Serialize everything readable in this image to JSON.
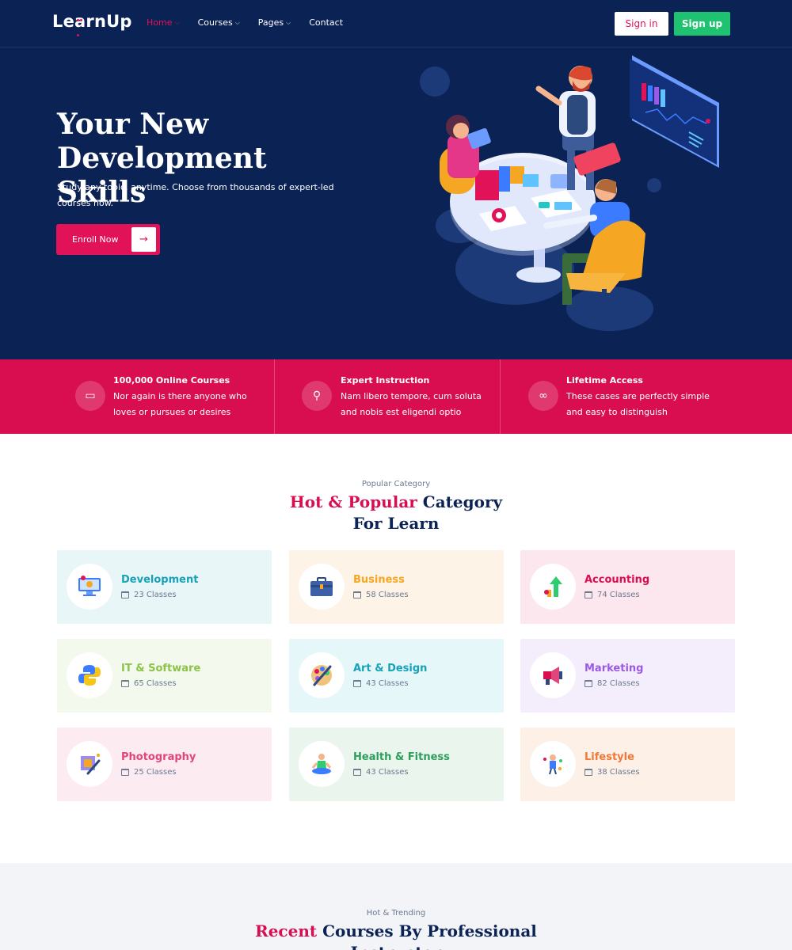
{
  "header": {
    "logo": "LearnUp",
    "nav": [
      {
        "label": "Home",
        "active": true,
        "dropdown": true
      },
      {
        "label": "Courses",
        "active": false,
        "dropdown": true
      },
      {
        "label": "Pages",
        "active": false,
        "dropdown": true
      },
      {
        "label": "Contact",
        "active": false,
        "dropdown": false
      }
    ],
    "signin_label": "Sign in",
    "signup_label": "Sign up"
  },
  "hero": {
    "title_line1": "Your New",
    "title_line2": "Development Skills",
    "subtitle": "Study any topic, anytime. Choose from thousands of expert-led courses now.",
    "cta_label": "Enroll Now"
  },
  "features": [
    {
      "icon": "video-icon",
      "title": "100,000 Online Courses",
      "text": "Nor again is there anyone who loves or pursues or desires"
    },
    {
      "icon": "award-icon",
      "title": "Expert Instruction",
      "text": "Nam libero tempore, cum soluta and nobis est eligendi optio"
    },
    {
      "icon": "infinity-icon",
      "title": "Lifetime Access",
      "text": "These cases are perfectly simple and easy to distinguish"
    }
  ],
  "categories": {
    "eyebrow": "Popular Category",
    "heading_accent": "Hot & Popular",
    "heading_rest": " Category For Learn",
    "items": [
      {
        "name": "Development",
        "count": "23 Classes",
        "color": "#17a2b8",
        "bg": "#e8f6f8",
        "icon": "monitor-icon"
      },
      {
        "name": "Business",
        "count": "58 Classes",
        "color": "#f5a623",
        "bg": "#fdf3e7",
        "icon": "briefcase-icon"
      },
      {
        "name": "Accounting",
        "count": "74 Classes",
        "color": "#d80e50",
        "bg": "#fce7ee",
        "icon": "growth-arrow-icon"
      },
      {
        "name": "IT & Software",
        "count": "65 Classes",
        "color": "#8bc34a",
        "bg": "#f3f9ec",
        "icon": "python-icon"
      },
      {
        "name": "Art & Design",
        "count": "43 Classes",
        "color": "#17a2b8",
        "bg": "#e6f7fa",
        "icon": "palette-icon"
      },
      {
        "name": "Marketing",
        "count": "82 Classes",
        "color": "#9b59e6",
        "bg": "#f4eefc",
        "icon": "megaphone-icon"
      },
      {
        "name": "Photography",
        "count": "25 Classes",
        "color": "#e0457b",
        "bg": "#fdebf2",
        "icon": "camera-icon"
      },
      {
        "name": "Health & Fitness",
        "count": "43 Classes",
        "color": "#2e9e5b",
        "bg": "#eaf5ee",
        "icon": "meditation-icon"
      },
      {
        "name": "Lifestyle",
        "count": "38 Classes",
        "color": "#f07838",
        "bg": "#fdf0e7",
        "icon": "lifestyle-icon"
      }
    ]
  },
  "trending": {
    "eyebrow": "Hot & Trending",
    "heading_accent": "Recent",
    "heading_rest": " Courses By Professional Instructor"
  },
  "colors": {
    "navy": "#0b2254",
    "primary": "#d80e50",
    "success": "#1ec270"
  }
}
